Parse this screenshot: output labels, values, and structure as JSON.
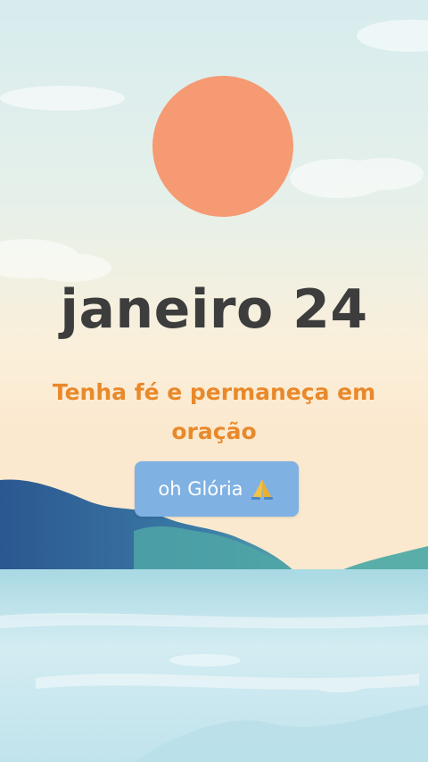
{
  "card": {
    "title": "janeiro 24",
    "subtitle": "Tenha fé e permaneça em oração",
    "cta_label": "oh Glória",
    "cta_icon": "praying-hands-icon"
  },
  "colors": {
    "sun": "#f59a72",
    "title": "#3d3d3d",
    "subtitle": "#e8892b",
    "button": "#7fb1e3",
    "mountain_dark": "#2f5f97",
    "mountain_teal": "#4fa6a6",
    "sea": "#cfe9f1"
  }
}
